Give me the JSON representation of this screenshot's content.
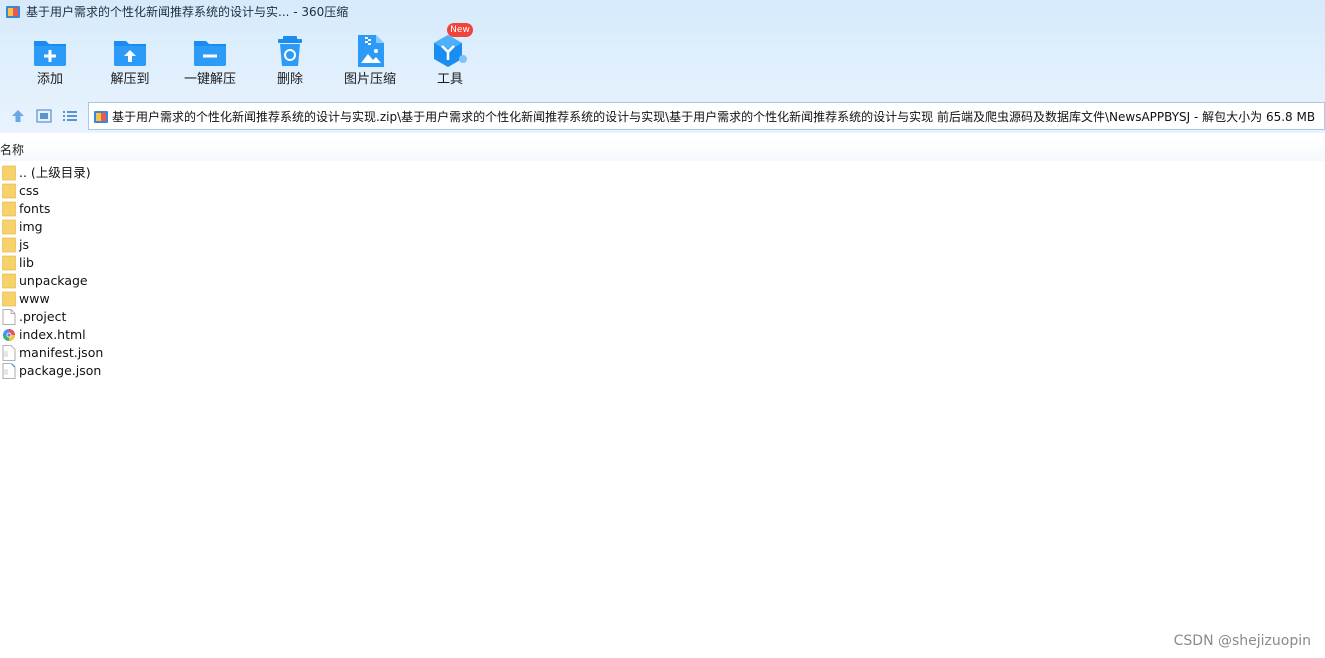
{
  "window": {
    "title": "基于用户需求的个性化新闻推荐系统的设计与实... - 360压缩",
    "app_icon": "archive-app-icon"
  },
  "toolbar": {
    "items": [
      {
        "label": "添加",
        "icon": "add-folder-icon"
      },
      {
        "label": "解压到",
        "icon": "extract-to-icon"
      },
      {
        "label": "一键解压",
        "icon": "one-click-extract-icon"
      },
      {
        "label": "删除",
        "icon": "delete-icon"
      },
      {
        "label": "图片压缩",
        "icon": "image-compress-icon"
      },
      {
        "label": "工具",
        "icon": "tools-icon",
        "badge": "New"
      }
    ]
  },
  "address_bar": {
    "path": "基于用户需求的个性化新闻推荐系统的设计与实现.zip\\基于用户需求的个性化新闻推荐系统的设计与实现\\基于用户需求的个性化新闻推荐系统的设计与实现 前后端及爬虫源码及数据库文件\\NewsAPPBYSJ - 解包大小为 65.8 MB"
  },
  "list_header": {
    "name_column": "名称"
  },
  "files": [
    {
      "name": ".. (上级目录)",
      "type": "folder"
    },
    {
      "name": "css",
      "type": "folder"
    },
    {
      "name": "fonts",
      "type": "folder"
    },
    {
      "name": "img",
      "type": "folder"
    },
    {
      "name": "js",
      "type": "folder"
    },
    {
      "name": "lib",
      "type": "folder"
    },
    {
      "name": "unpackage",
      "type": "folder"
    },
    {
      "name": "www",
      "type": "folder"
    },
    {
      "name": ".project",
      "type": "file"
    },
    {
      "name": "index.html",
      "type": "html"
    },
    {
      "name": "manifest.json",
      "type": "json"
    },
    {
      "name": "package.json",
      "type": "json"
    }
  ],
  "watermark": "CSDN @shejizuopin",
  "colors": {
    "accent": "#1a8ef0",
    "folder": "#f7d26b",
    "badge": "#f2433a"
  }
}
